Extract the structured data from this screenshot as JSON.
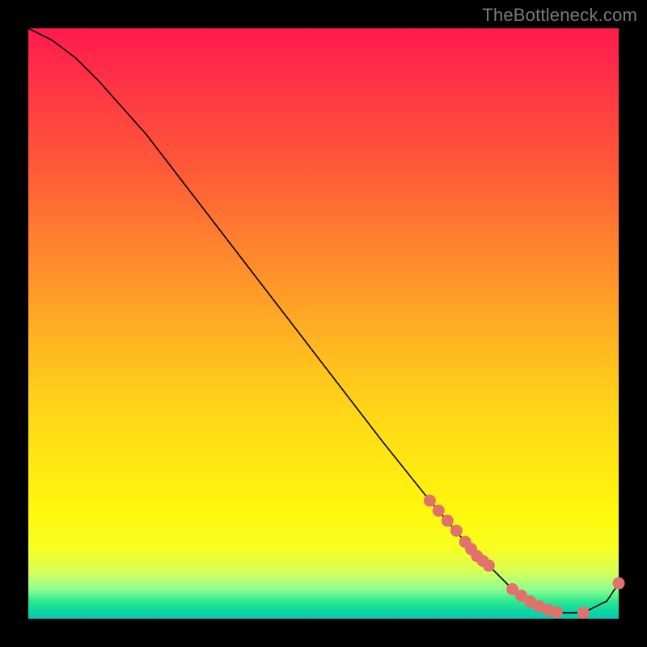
{
  "watermark": "TheBottleneck.com",
  "chart_data": {
    "type": "line",
    "title": "",
    "xlabel": "",
    "ylabel": "",
    "xlim": [
      0,
      100
    ],
    "ylim": [
      0,
      100
    ],
    "grid": false,
    "legend": false,
    "series": [
      {
        "name": "bottleneck-curve",
        "x": [
          0,
          4,
          8,
          12,
          20,
          30,
          40,
          50,
          60,
          68,
          74,
          78,
          82,
          86,
          90,
          94,
          98,
          100
        ],
        "values": [
          100,
          98,
          95,
          91,
          82,
          69,
          56,
          43,
          30,
          20,
          13,
          9,
          5,
          2,
          1,
          1,
          3,
          6
        ]
      }
    ],
    "points": {
      "name": "highlight-dots",
      "color": "#e2716b",
      "x": [
        68,
        69.5,
        71,
        72.5,
        74,
        75,
        76,
        77,
        78,
        82,
        83.5,
        85,
        86.5,
        88,
        89.5,
        94,
        100
      ],
      "values": [
        20,
        18.3,
        16.6,
        14.9,
        13,
        11.8,
        10.6,
        9.8,
        9,
        5,
        3.9,
        2.9,
        2.1,
        1.5,
        1.1,
        1,
        6
      ]
    },
    "colors": {
      "gradient_top": "#ff1a4d",
      "gradient_mid": "#ffe812",
      "gradient_bottom": "#08c8b8",
      "curve": "#000000",
      "dots": "#e2716b",
      "background": "#000000"
    }
  }
}
